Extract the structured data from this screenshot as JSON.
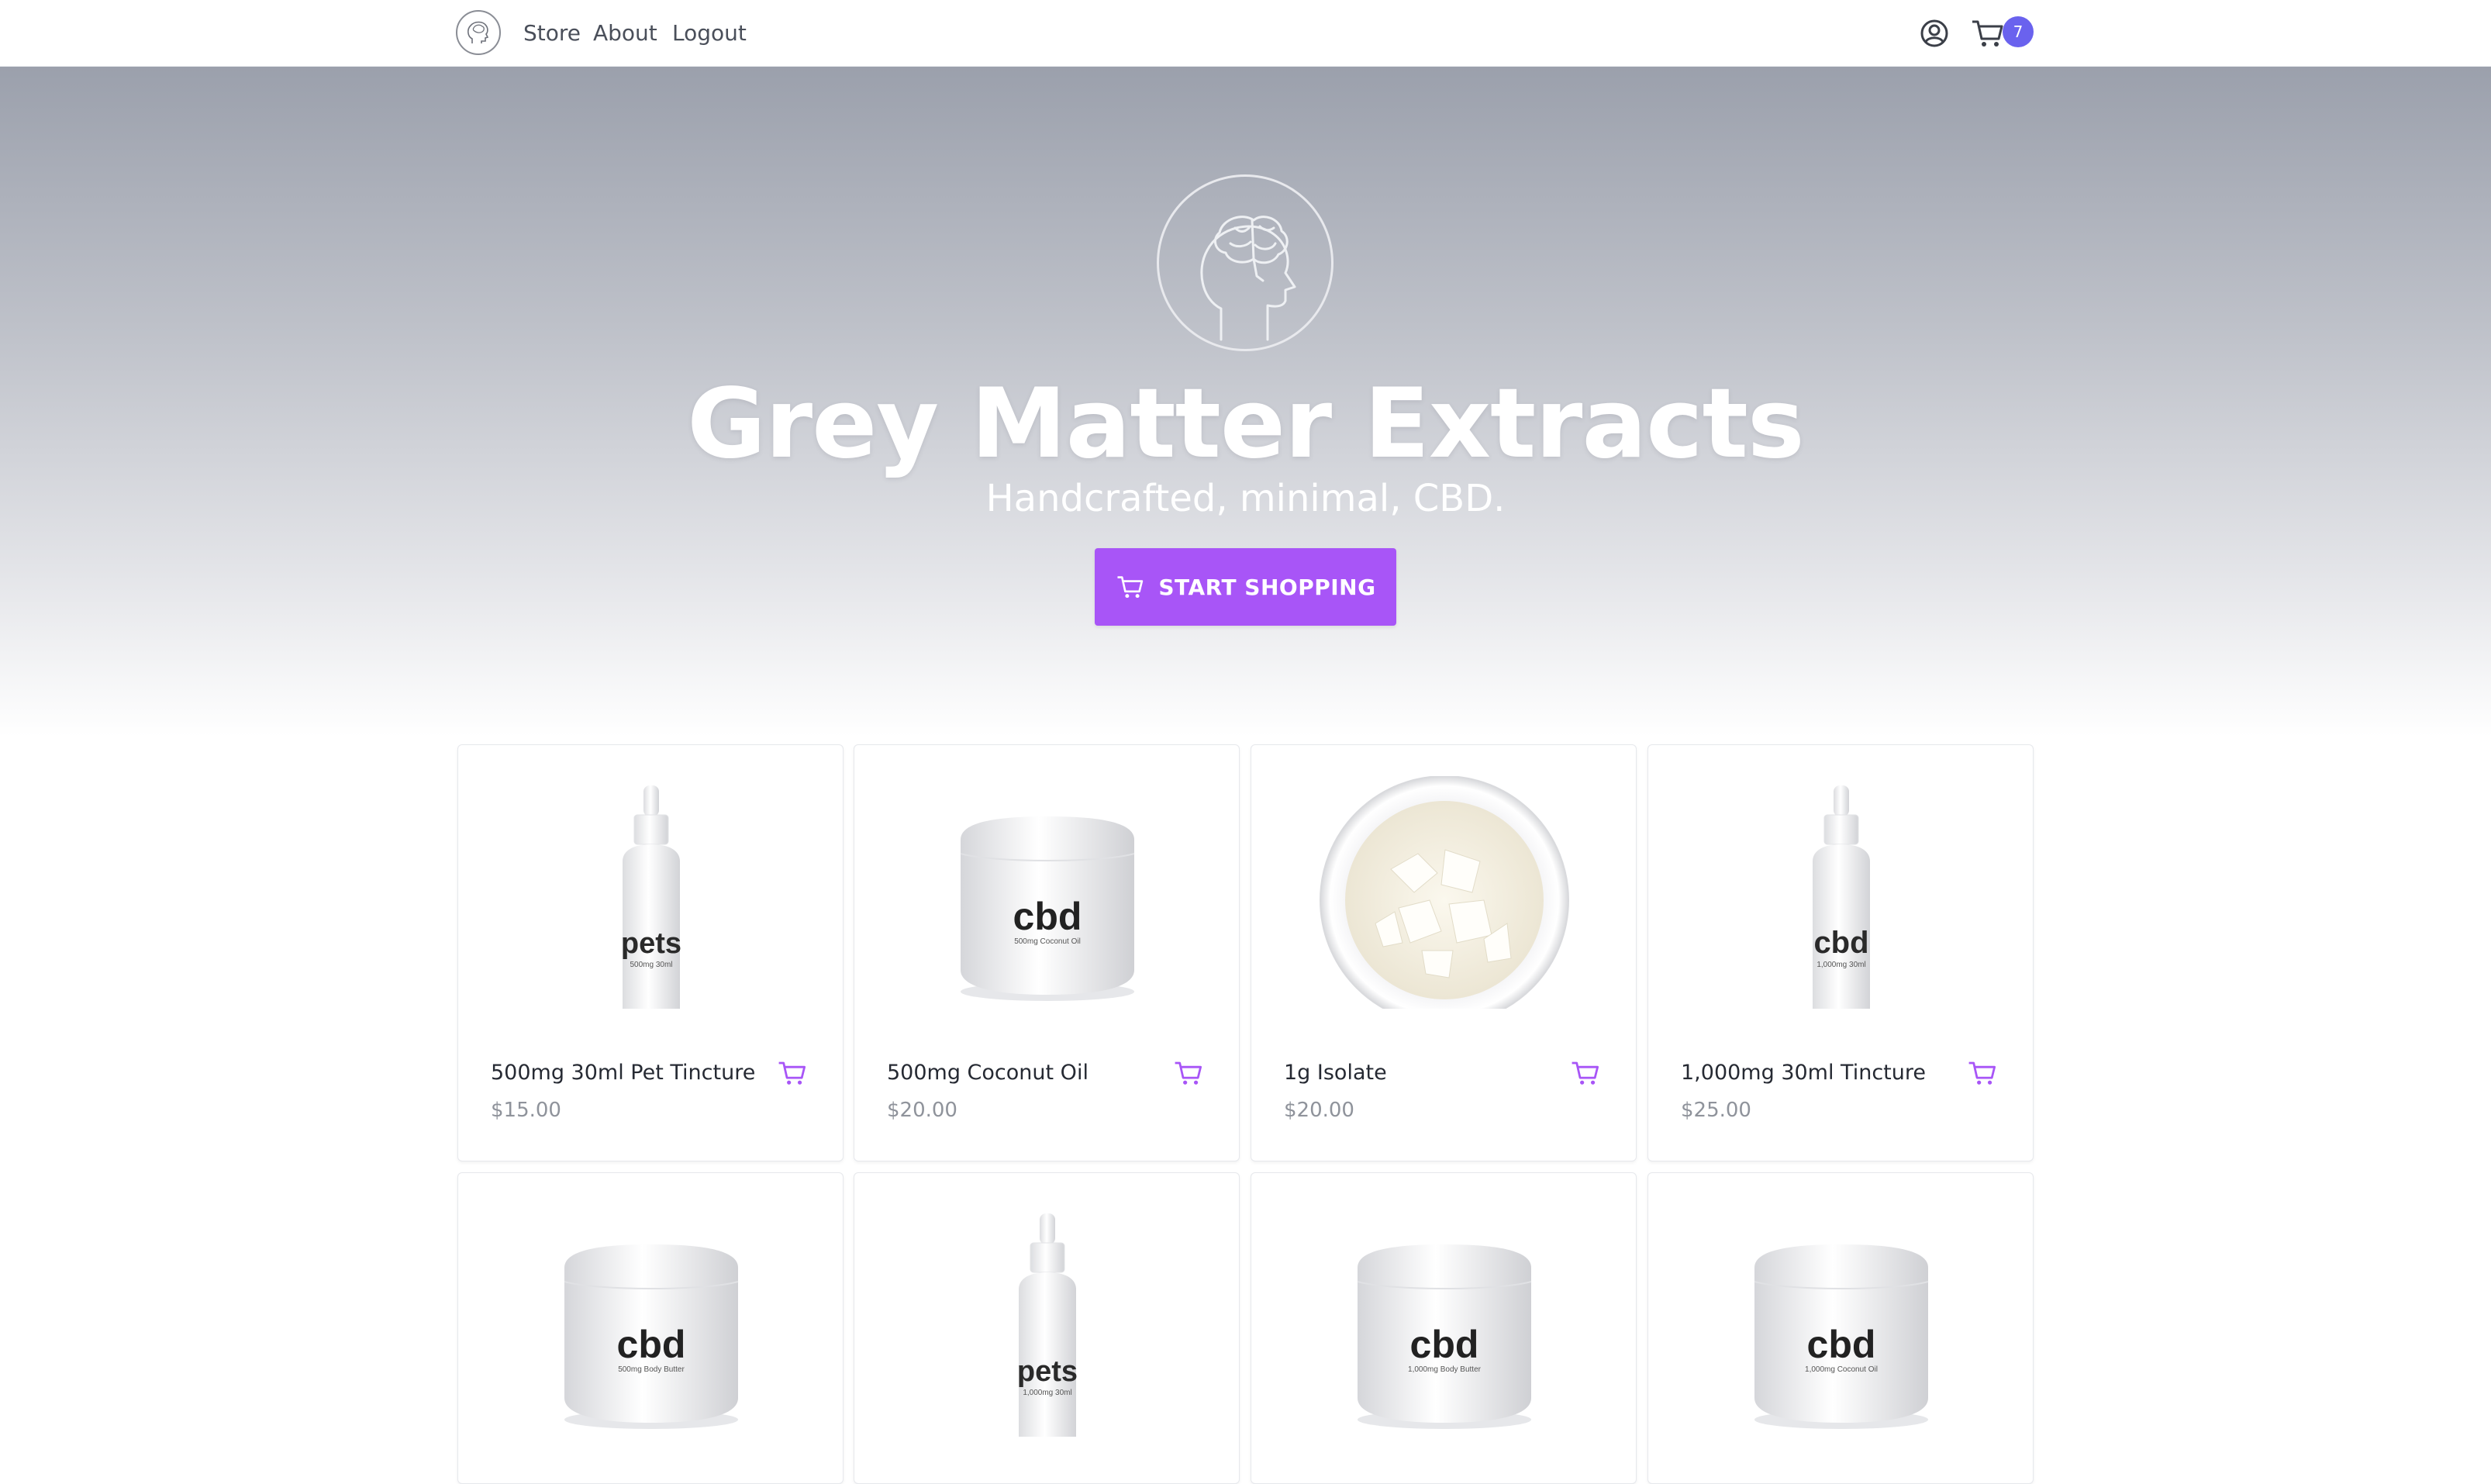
{
  "nav": {
    "logo_icon": "brain-head-icon",
    "links": [
      "Store",
      "About",
      "Logout"
    ],
    "user_icon": "user-circle-icon",
    "cart_icon": "cart-icon",
    "cart_count": "7"
  },
  "hero": {
    "logo_icon": "brain-head-icon",
    "title": "Grey Matter Extracts",
    "subtitle": "Handcrafted, minimal, CBD.",
    "button_icon": "cart-icon",
    "button_label": "START SHOPPING"
  },
  "colors": {
    "accent": "#a855f7",
    "badge": "#6a62ee",
    "text": "#262a33",
    "muted": "#8f939b"
  },
  "products": [
    {
      "name": "500mg 30ml Pet Tincture",
      "price": "$15.00",
      "image": "dropper-bottle",
      "brand": "pets",
      "label": "500mg 30ml"
    },
    {
      "name": "500mg Coconut Oil",
      "price": "$20.00",
      "image": "jar",
      "brand": "cbd",
      "label": "500mg Coconut Oil"
    },
    {
      "name": "1g Isolate",
      "price": "$20.00",
      "image": "isolate-dish",
      "brand": "",
      "label": ""
    },
    {
      "name": "1,000mg 30ml Tincture",
      "price": "$25.00",
      "image": "dropper-bottle",
      "brand": "cbd",
      "label": "1,000mg 30ml"
    },
    {
      "name": "",
      "price": "",
      "image": "jar",
      "brand": "cbd",
      "label": "500mg Body Butter"
    },
    {
      "name": "",
      "price": "",
      "image": "dropper-bottle",
      "brand": "pets",
      "label": "1,000mg 30ml"
    },
    {
      "name": "",
      "price": "",
      "image": "jar",
      "brand": "cbd",
      "label": "1,000mg Body Butter"
    },
    {
      "name": "",
      "price": "",
      "image": "jar",
      "brand": "cbd",
      "label": "1,000mg Coconut Oil"
    }
  ]
}
